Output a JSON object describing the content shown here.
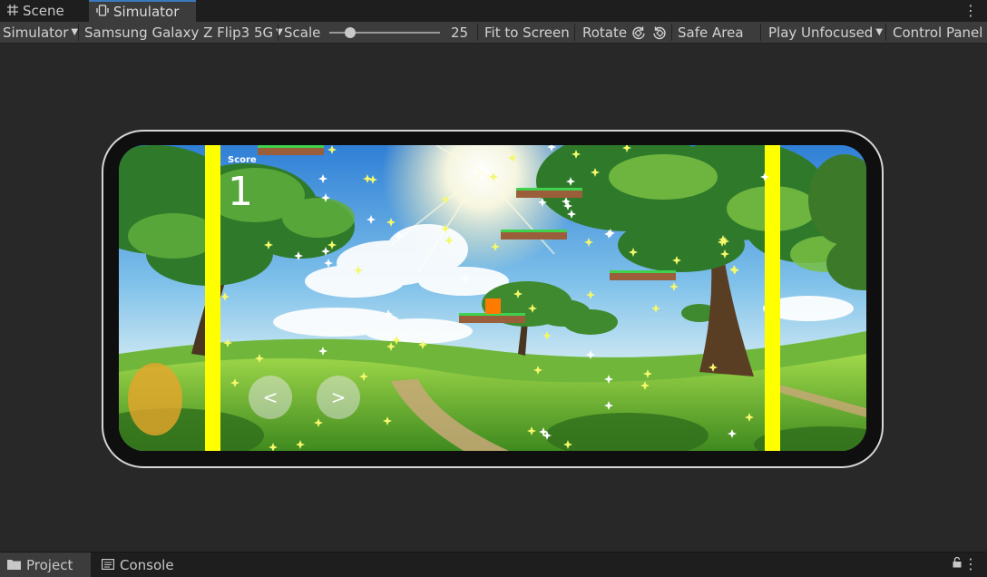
{
  "tabs": {
    "scene": {
      "label": "Scene",
      "icon": "grid-icon"
    },
    "simulator": {
      "label": "Simulator",
      "icon": "device-icon"
    }
  },
  "toolbar": {
    "simulator_dropdown": "Simulator",
    "device_dropdown": "Samsung Galaxy Z Flip3 5G",
    "scale_label": "Scale",
    "scale_value": "25",
    "fit_to_screen": "Fit to Screen",
    "rotate": "Rotate",
    "safe_area": "Safe Area",
    "play_mode_dropdown": "Play Unfocused",
    "control_panel": "Control Panel"
  },
  "game": {
    "score_label": "Score",
    "score_value": "1",
    "left_button": "<",
    "right_button": ">"
  },
  "bottom": {
    "project": "Project",
    "console": "Console"
  },
  "colors": {
    "accent": "#3a79bb",
    "side_bars": "#ffff00",
    "player": "#ff7a00",
    "platform_top": "#3ed24e",
    "platform_body": "#9b5e3a"
  }
}
